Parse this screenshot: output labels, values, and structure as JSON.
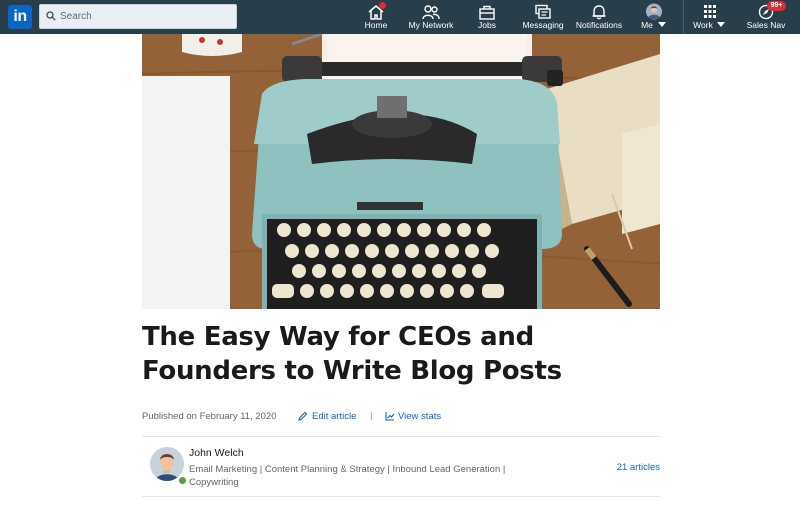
{
  "topnav": {
    "search_placeholder": "Search",
    "items": [
      {
        "label": "Home",
        "icon": "home-icon"
      },
      {
        "label": "My Network",
        "icon": "network-icon"
      },
      {
        "label": "Jobs",
        "icon": "briefcase-icon"
      },
      {
        "label": "Messaging",
        "icon": "messaging-icon"
      },
      {
        "label": "Notifications",
        "icon": "bell-icon"
      },
      {
        "label": "Me",
        "icon": "profile-avatar"
      },
      {
        "label": "Work",
        "icon": "grid-icon"
      },
      {
        "label": "Sales Nav",
        "icon": "compass-icon"
      }
    ],
    "sales_nav_badge": "99+"
  },
  "article": {
    "title": "The Easy Way for CEOs and Founders to Write Blog Posts",
    "published": "Published on February 11, 2020",
    "edit_label": "Edit article",
    "stats_label": "View stats"
  },
  "author": {
    "name": "John Welch",
    "headline": "Email Marketing | Content Planning & Strategy | Inbound Lead Generation | Copywriting",
    "articles_link": "21 articles"
  },
  "colors": {
    "nav_bg": "#283e4a",
    "link": "#0a66c2",
    "badge": "#e02c36"
  }
}
